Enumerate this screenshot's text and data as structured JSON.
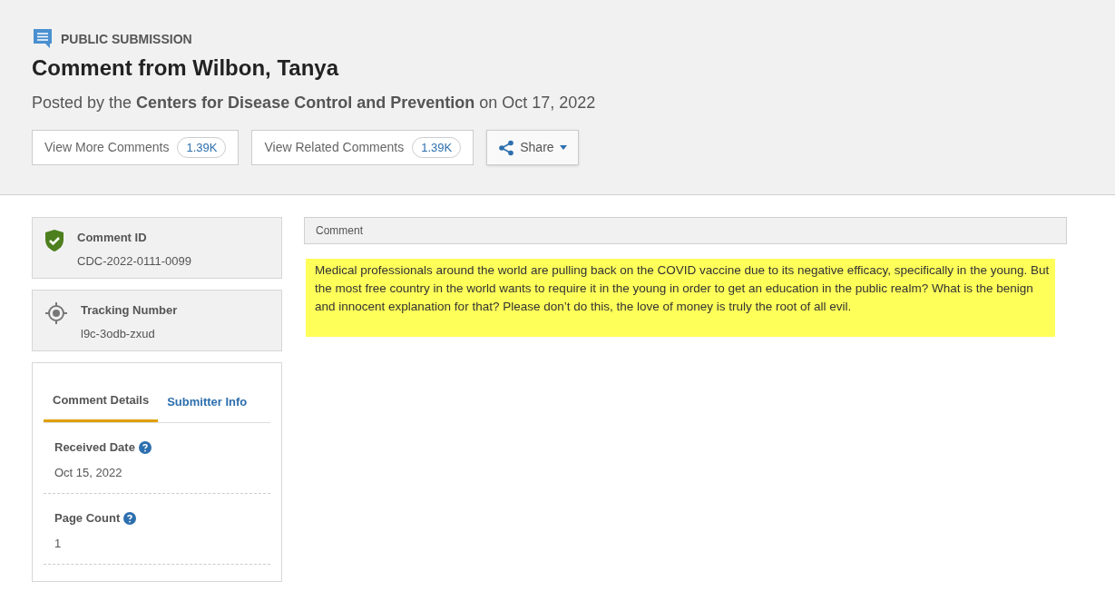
{
  "header": {
    "category": "PUBLIC SUBMISSION",
    "title": "Comment from Wilbon, Tanya",
    "posted_by": "Posted by the **Centers for Disease Control and Prevention** on Oct 17, 2022",
    "buttons": [
      {
        "kind": "count",
        "label": "View More Comments",
        "count": "1.39K"
      },
      {
        "kind": "count",
        "label": "View Related Comments",
        "count": "1.39K"
      },
      {
        "kind": "share",
        "label": "Share"
      }
    ]
  },
  "id_cards": [
    {
      "kind": "shield",
      "label": "Comment ID",
      "value": "CDC-2022-0111-0099"
    },
    {
      "kind": "target",
      "label": "Tracking Number",
      "value": "l9c-3odb-zxud"
    }
  ],
  "details": {
    "tabs": [
      {
        "label": "Comment Details",
        "selected": true
      },
      {
        "label": "Submitter Info",
        "selected": false
      }
    ],
    "fields": [
      {
        "label": "Received Date",
        "value": "Oct 15, 2022"
      },
      {
        "label": "Page Count",
        "value": "1"
      }
    ]
  },
  "comment": {
    "heading": "Comment",
    "text": "Medical professionals around the world are pulling back on the COVID vaccine due to its negative efficacy, specifically in the young. But the most free country in the world wants to require it in the young in order to get an education in the public realm? What is the benign and innocent explanation for that? Please don’t do this, the love of money is truly the root of all evil."
  }
}
